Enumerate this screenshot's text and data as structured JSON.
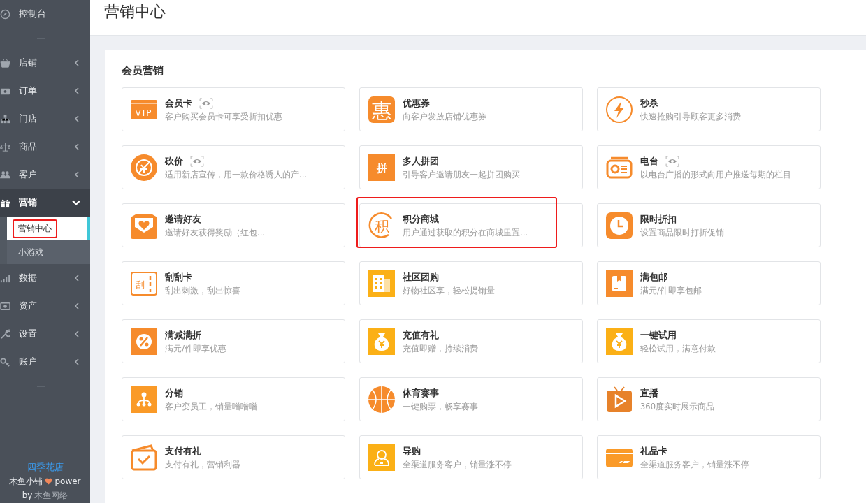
{
  "sidebar": {
    "items": [
      {
        "label": "控制台",
        "kind": "plain",
        "selected": false
      },
      {
        "kind": "divider"
      },
      {
        "label": "店铺",
        "kind": "menu",
        "selected": false,
        "expanded": false
      },
      {
        "label": "订单",
        "kind": "menu",
        "selected": false,
        "expanded": false
      },
      {
        "label": "门店",
        "kind": "menu",
        "selected": false,
        "expanded": false
      },
      {
        "label": "商品",
        "kind": "menu",
        "selected": false,
        "expanded": false
      },
      {
        "label": "客户",
        "kind": "menu",
        "selected": false,
        "expanded": false
      },
      {
        "label": "营销",
        "kind": "menu",
        "selected": true,
        "expanded": true,
        "children": [
          {
            "label": "营销中心",
            "selected": true,
            "highlighted": true
          },
          {
            "label": "小游戏",
            "selected": false,
            "highlighted": false
          }
        ]
      },
      {
        "label": "数据",
        "kind": "menu",
        "selected": false,
        "expanded": false
      },
      {
        "label": "资产",
        "kind": "menu",
        "selected": false,
        "expanded": false
      },
      {
        "label": "设置",
        "kind": "menu",
        "selected": false,
        "expanded": false
      },
      {
        "label": "账户",
        "kind": "menu",
        "selected": false,
        "expanded": false
      },
      {
        "kind": "divider"
      }
    ],
    "shop_name": "四季花店",
    "powered": "木鱼小铺",
    "powered_suffix": "power",
    "by": "by",
    "company": "木鱼网络"
  },
  "page_title": "营销中心",
  "section_title": "会员营销",
  "cards": [
    {
      "title": "会员卡",
      "desc": "客户购买会员卡可享受折扣优惠",
      "preview": true,
      "highlighted": false,
      "icon_text": "VIP"
    },
    {
      "title": "优惠券",
      "desc": "向客户发放店铺优惠券",
      "preview": false,
      "highlighted": false,
      "icon_text": "惠"
    },
    {
      "title": "秒杀",
      "desc": "快速抢购引导顾客更多消费",
      "preview": false,
      "highlighted": false
    },
    {
      "title": "砍价",
      "desc": "适用新店宣传，用一款价格诱人的产...",
      "preview": true,
      "highlighted": false
    },
    {
      "title": "多人拼团",
      "desc": "引导客户邀请朋友一起拼团购买",
      "preview": false,
      "highlighted": false,
      "icon_text": "拼"
    },
    {
      "title": "电台",
      "desc": "以电台广播的形式向用户推送每期的栏目",
      "preview": true,
      "highlighted": false
    },
    {
      "title": "邀请好友",
      "desc": "邀请好友获得奖励（红包...",
      "preview": false,
      "highlighted": false
    },
    {
      "title": "积分商城",
      "desc": "用户通过获取的积分在商城里置...",
      "preview": false,
      "highlighted": true,
      "icon_text": "积"
    },
    {
      "title": "限时折扣",
      "desc": "设置商品限时打折促销",
      "preview": false,
      "highlighted": false
    },
    {
      "title": "刮刮卡",
      "desc": "刮出刺激，刮出惊喜",
      "preview": false,
      "highlighted": false,
      "icon_text": "刮"
    },
    {
      "title": "社区团购",
      "desc": "好物社区享，轻松提销量",
      "preview": false,
      "highlighted": false
    },
    {
      "title": "满包邮",
      "desc": "满元/件即享包邮",
      "preview": false,
      "highlighted": false
    },
    {
      "title": "满减满折",
      "desc": "满元/件即享优惠",
      "preview": false,
      "highlighted": false
    },
    {
      "title": "充值有礼",
      "desc": "充值即赠，持续消费",
      "preview": false,
      "highlighted": false
    },
    {
      "title": "一键试用",
      "desc": "轻松试用，满意付款",
      "preview": false,
      "highlighted": false
    },
    {
      "title": "分销",
      "desc": "客户变员工，销量噌噌噌",
      "preview": false,
      "highlighted": false
    },
    {
      "title": "体育赛事",
      "desc": "一键购票，畅享赛事",
      "preview": false,
      "highlighted": false
    },
    {
      "title": "直播",
      "desc": "360度实时展示商品",
      "preview": false,
      "highlighted": false
    },
    {
      "title": "支付有礼",
      "desc": "支付有礼，营销利器",
      "preview": false,
      "highlighted": false
    },
    {
      "title": "导购",
      "desc": "全渠道服务客户，销量涨不停",
      "preview": false,
      "highlighted": false
    },
    {
      "title": "礼品卡",
      "desc": "全渠道服务客户，销量涨不停",
      "preview": false,
      "highlighted": false
    }
  ]
}
